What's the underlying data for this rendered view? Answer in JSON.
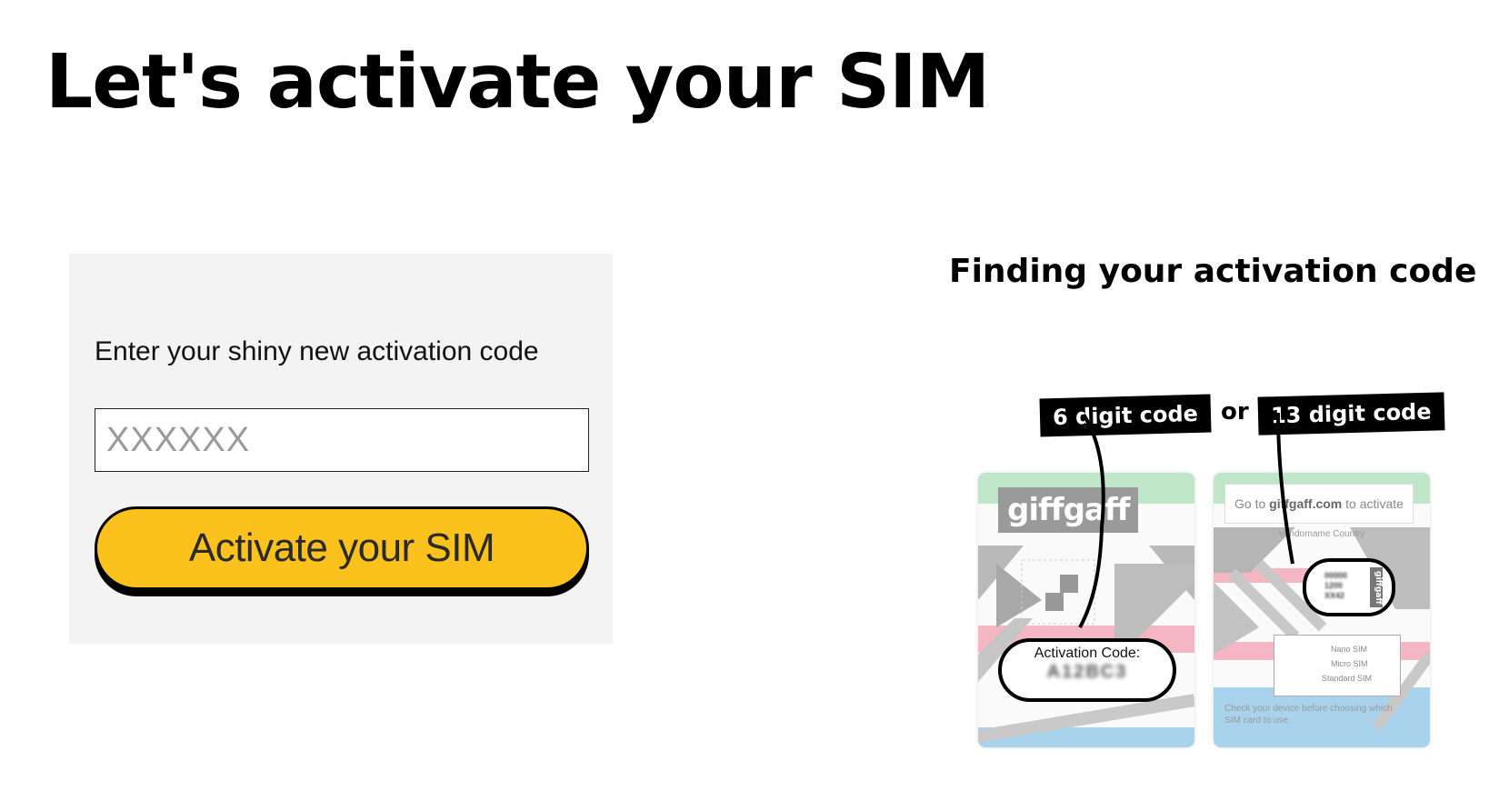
{
  "header": {
    "title": "Let's activate your SIM"
  },
  "form": {
    "label": "Enter your shiny new activation code",
    "input_placeholder": "XXXXXX",
    "input_value": "",
    "button_label": "Activate your SIM"
  },
  "help": {
    "title": "Finding your activation code",
    "tag_six": "6 digit code",
    "or_text": "or",
    "tag_thirteen": "13 digit code",
    "left_card": {
      "brand": "giffgaff",
      "code_label": "Activation Code:",
      "code_value": "A12BC3"
    },
    "right_card": {
      "go_to_prefix": "Go to ",
      "go_to_site": "giffgaff.com",
      "go_to_suffix": " to activate",
      "vendor": "Vendorname Country",
      "sim_digits_1": "00000",
      "sim_digits_2": "1200",
      "sim_digits_3": "XX42",
      "sim_brand": "giffgaff",
      "size_nano": "Nano SIM",
      "size_micro": "Micro SIM",
      "size_standard": "Standard SIM",
      "check_text": "Check your device before choosing which SIM card to use."
    }
  },
  "colors": {
    "button": "#fbc21e",
    "panel": "#f3f3f3",
    "card_green": "#bfe6c8",
    "card_pink": "#f3b6c2",
    "card_blue": "#a9d3ec"
  }
}
